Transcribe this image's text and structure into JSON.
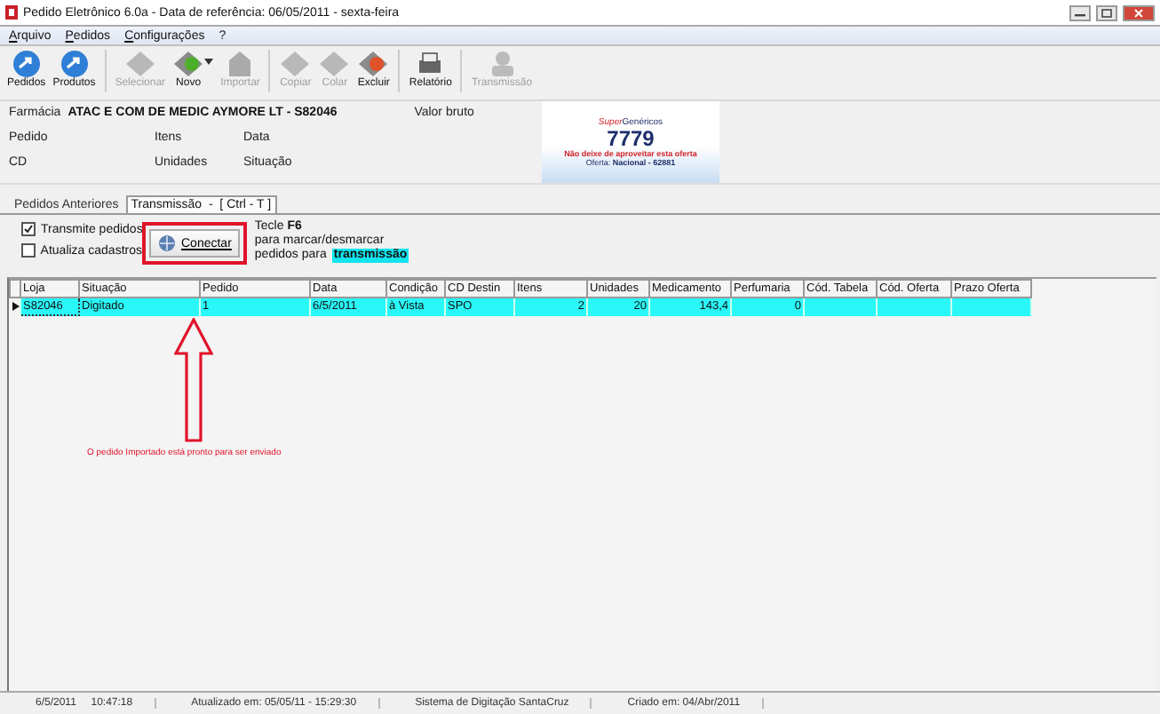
{
  "window": {
    "title": "Pedido Eletrônico 6.0a - Data de referência: 06/05/2011 - sexta-feira"
  },
  "menu": [
    "Arquivo",
    "Pedidos",
    "Configurações",
    "?"
  ],
  "toolbar": [
    {
      "label": "Pedidos",
      "disabled": false
    },
    {
      "label": "Produtos",
      "disabled": false
    },
    {
      "label": "Selecionar",
      "disabled": true
    },
    {
      "label": "Novo",
      "disabled": false
    },
    {
      "label": "Importar",
      "disabled": true
    },
    {
      "label": "Copiar",
      "disabled": true
    },
    {
      "label": "Colar",
      "disabled": true
    },
    {
      "label": "Excluir",
      "disabled": false
    },
    {
      "label": "Relatório",
      "disabled": false
    },
    {
      "label": "Transmissão",
      "disabled": true
    }
  ],
  "info": {
    "pharmacy_label": "Farmácia",
    "pharmacy_value": "ATAC E COM DE MEDIC AYMORE LT - S82046",
    "gross_value_label": "Valor bruto",
    "fields": [
      [
        "Pedido",
        "Itens",
        "Data"
      ],
      [
        "CD",
        "Unidades",
        "Situação"
      ]
    ]
  },
  "banner": {
    "brand_top": "Super",
    "brand": "Genéricos",
    "number": "7779",
    "headline": "Não deixe de aproveitar esta oferta",
    "offer": "Oferta: **Nacional - 62881**"
  },
  "tabs": [
    {
      "label": "Pedidos Anteriores",
      "selected": false
    },
    {
      "label": "Transmissão  -  [ Ctrl - T ]",
      "selected": true
    }
  ],
  "options": [
    {
      "label": "Transmite pedidos",
      "checked": true
    },
    {
      "label": "Atualiza cadastros",
      "checked": false
    }
  ],
  "connect_button": "Conectar",
  "hint": {
    "line1": "Tecle **F6**",
    "line2": "para marcar/desmarcar",
    "line3": "pedidos para",
    "badge": "transmissão"
  },
  "table": {
    "columns": [
      "Loja",
      "Situação",
      "Pedido",
      "Data",
      "Condição",
      "CD Destin",
      "Itens",
      "Unidades",
      "Medicamento",
      "Perfumaria",
      "Cód. Tabela",
      "Cód. Oferta",
      "Prazo Oferta"
    ],
    "rows": [
      {
        "selected": true,
        "cells": [
          "S82046",
          "Digitado",
          "1",
          "6/5/2011",
          "à Vista",
          "SPO",
          "2",
          "20",
          "143,4",
          "0",
          "",
          "",
          ""
        ]
      }
    ]
  },
  "annotation": {
    "message": "O pedido Importado está pronto para ser enviado"
  },
  "status_bar": [
    "6/5/2011     10:47:18",
    "Atualizado em: 05/05/11 - 15:29:30",
    "Sistema de Digitação SantaCruz",
    "Criado em: 04/Abr/2011"
  ]
}
